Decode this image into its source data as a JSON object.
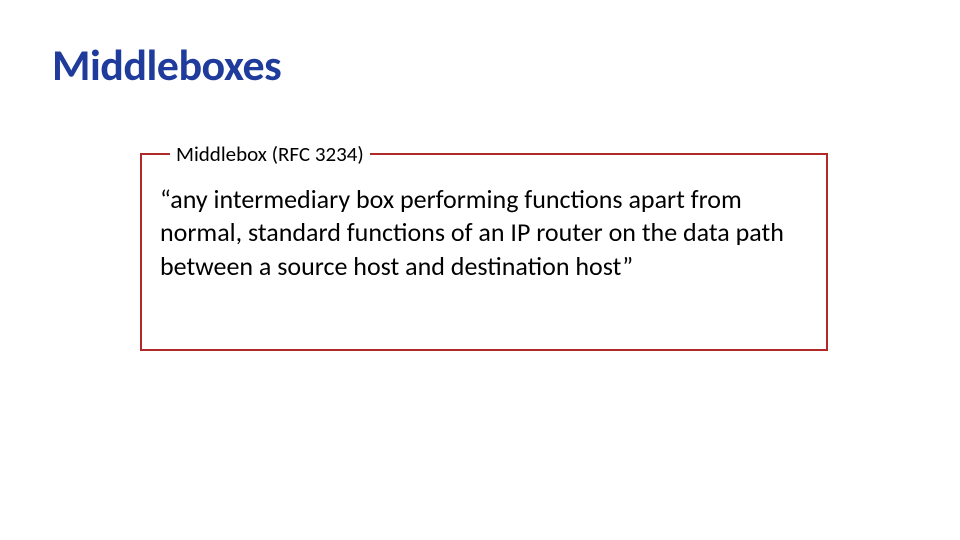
{
  "slide": {
    "title": "Middleboxes",
    "box": {
      "legend": "Middlebox (RFC  3234)",
      "body": "“any intermediary box performing functions apart from normal, standard functions of an IP router on the data path between a source host and destination host”"
    }
  }
}
